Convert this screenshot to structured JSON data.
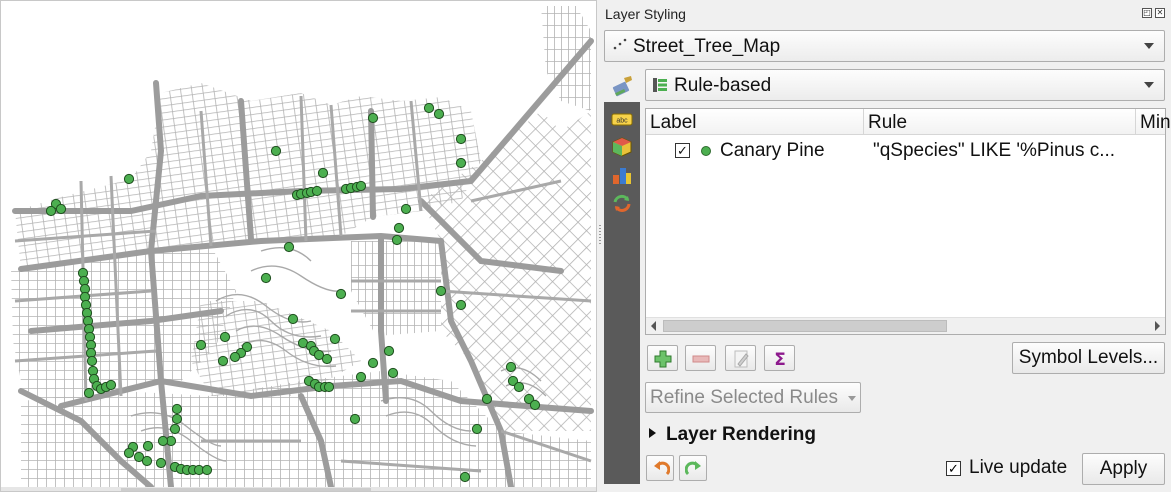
{
  "panel": {
    "title": "Layer Styling"
  },
  "layer_select": {
    "value": "Street_Tree_Map",
    "icon": "point-layer-icon"
  },
  "renderer_select": {
    "value": "Rule-based",
    "icon": "rule-based-renderer-icon"
  },
  "side_tabs": [
    "labels-tab-icon",
    "3d-view-tab-icon",
    "diagrams-tab-icon",
    "history-tab-icon"
  ],
  "rules_table": {
    "columns": [
      "Label",
      "Rule",
      "Min"
    ],
    "rows": [
      {
        "checked": true,
        "label": "Canary Pine",
        "rule": "\"qSpecies\" LIKE '%Pinus c...",
        "symbol_color": "#4caf50"
      }
    ]
  },
  "toolbar": {
    "add_rule": "add-rule-icon",
    "remove_rule": "remove-rule-icon",
    "edit_rule": "edit-rule-icon",
    "count_features": "sigma-icon"
  },
  "buttons": {
    "symbol_levels": "Symbol Levels...",
    "refine_selected_rules": "Refine Selected Rules",
    "apply": "Apply"
  },
  "layer_rendering": {
    "label": "Layer Rendering",
    "expanded": false
  },
  "live_update": {
    "label": "Live update",
    "checked": true
  },
  "colors": {
    "street_lines": "#a9a9a9",
    "tree_points": "#4caf50",
    "tree_outline": "#1f4f1f",
    "tab_strip": "#5a5a5a"
  }
}
